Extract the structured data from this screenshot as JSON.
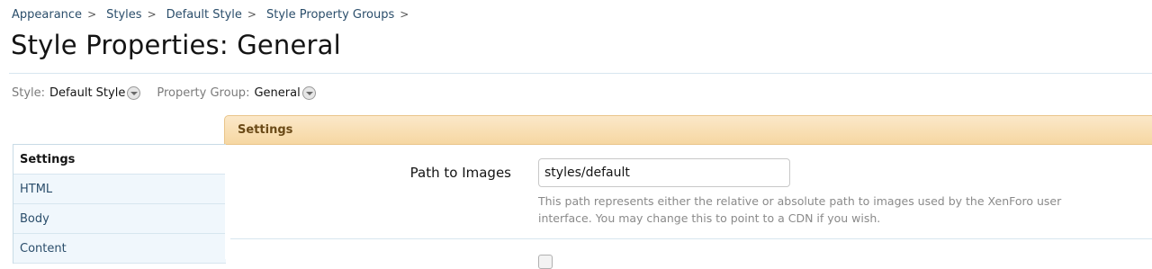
{
  "breadcrumb": [
    {
      "label": "Appearance",
      "sep": ">"
    },
    {
      "label": "Styles",
      "sep": ">"
    },
    {
      "label": "Default Style",
      "sep": ">"
    },
    {
      "label": "Style Property Groups",
      "sep": ">"
    }
  ],
  "page_title": "Style Properties: General",
  "filters": {
    "style_label": "Style:",
    "style_value": "Default Style",
    "group_label": "Property Group:",
    "group_value": "General"
  },
  "sidebar": {
    "items": [
      {
        "label": "Settings",
        "active": true
      },
      {
        "label": "HTML",
        "active": false
      },
      {
        "label": "Body",
        "active": false
      },
      {
        "label": "Content",
        "active": false
      }
    ]
  },
  "section": {
    "title": "Settings"
  },
  "fields": [
    {
      "label": "Path to Images",
      "value": "styles/default",
      "explain": "This path represents either the relative or absolute path to images used by the XenForo user interface. You may change this to point to a CDN if you wish."
    }
  ],
  "colors": {
    "link": "#2b4e6b",
    "header_bg": "#f6d7a2",
    "header_text": "#6b4a17",
    "sidebar_bg": "#f0f7fc",
    "rule": "#d7e6ef"
  }
}
